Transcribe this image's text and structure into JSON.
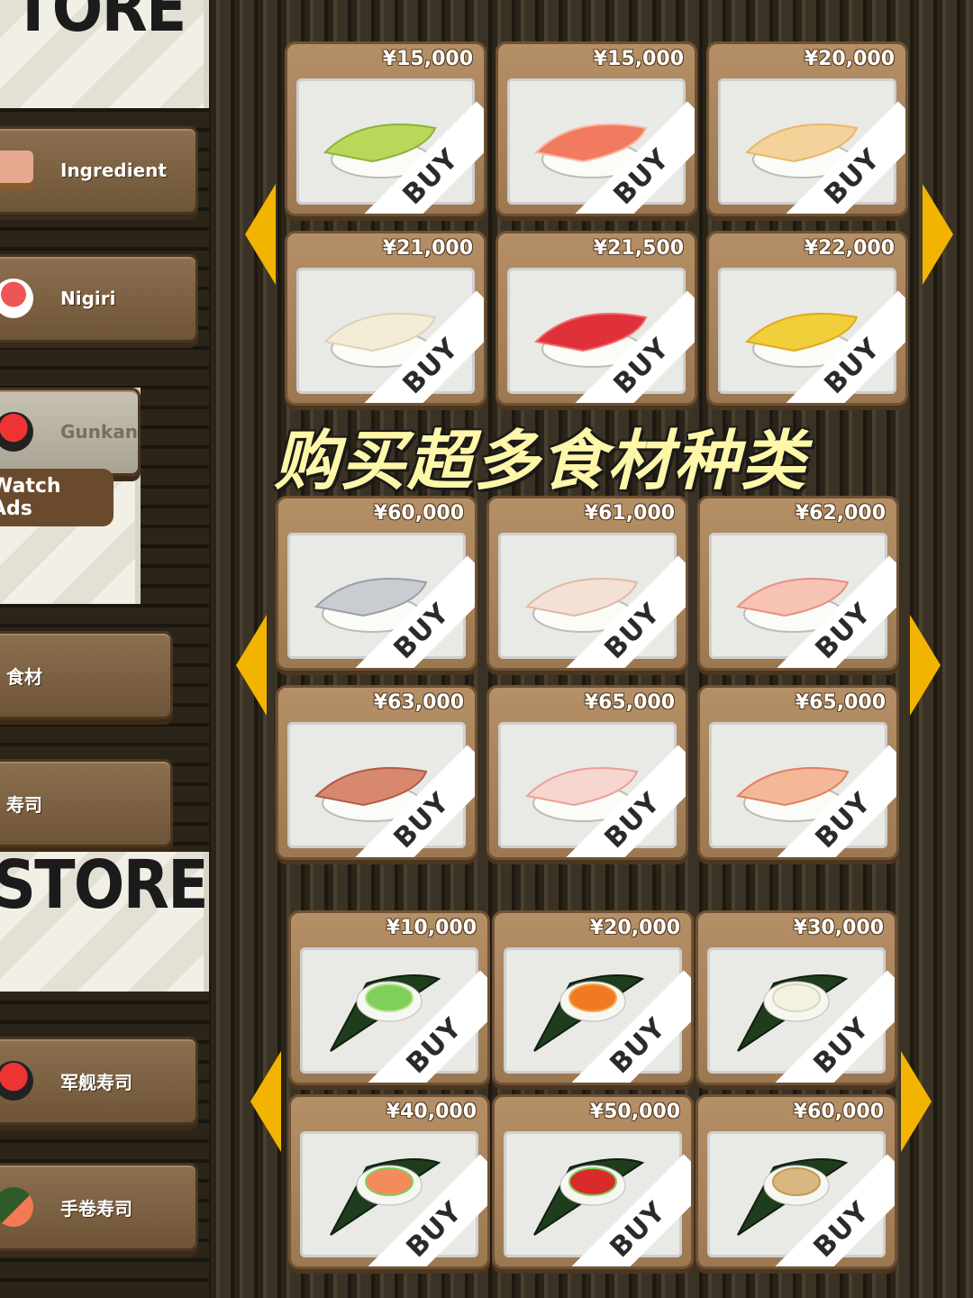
{
  "left_panel": {
    "store_title_top": "TORE",
    "store_title_bottom": "STORE",
    "menu": [
      {
        "label": "Ingredient"
      },
      {
        "label": "Nigiri"
      },
      {
        "label": "Gunkan"
      },
      {
        "label": "食材"
      },
      {
        "label": "寿司"
      },
      {
        "label": "军舰寿司"
      },
      {
        "label": "手卷寿司"
      }
    ],
    "watch_ads": "Watch Ads"
  },
  "headline": "购买超多食材种类",
  "buy_label": "BUY",
  "sections": [
    {
      "items": [
        {
          "price": "¥15,000",
          "food": "avocado-nigiri"
        },
        {
          "price": "¥15,000",
          "food": "shrimp-nigiri"
        },
        {
          "price": "¥20,000",
          "food": "scallop-nigiri"
        },
        {
          "price": "¥21,000",
          "food": "white-fish-nigiri"
        },
        {
          "price": "¥21,500",
          "food": "tuna-nigiri"
        },
        {
          "price": "¥22,000",
          "food": "tempura-shrimp-nigiri"
        }
      ]
    },
    {
      "items": [
        {
          "price": "¥60,000",
          "food": "whitebait-nigiri"
        },
        {
          "price": "¥61,000",
          "food": "sea-bream-nigiri"
        },
        {
          "price": "¥62,000",
          "food": "yellowtail-nigiri"
        },
        {
          "price": "¥63,000",
          "food": "mackerel-nigiri"
        },
        {
          "price": "¥65,000",
          "food": "snapper-nigiri"
        },
        {
          "price": "¥65,000",
          "food": "amberjack-nigiri"
        }
      ]
    },
    {
      "items": [
        {
          "price": "¥10,000",
          "food": "cucumber-temaki"
        },
        {
          "price": "¥20,000",
          "food": "roe-temaki"
        },
        {
          "price": "¥30,000",
          "food": "squid-temaki"
        },
        {
          "price": "¥40,000",
          "food": "salmon-temaki"
        },
        {
          "price": "¥50,000",
          "food": "tuna-temaki"
        },
        {
          "price": "¥60,000",
          "food": "natto-temaki"
        }
      ]
    }
  ],
  "colors": {
    "accent": "#f2b400",
    "card": "#b08a62",
    "headline": "#fff7a8"
  }
}
